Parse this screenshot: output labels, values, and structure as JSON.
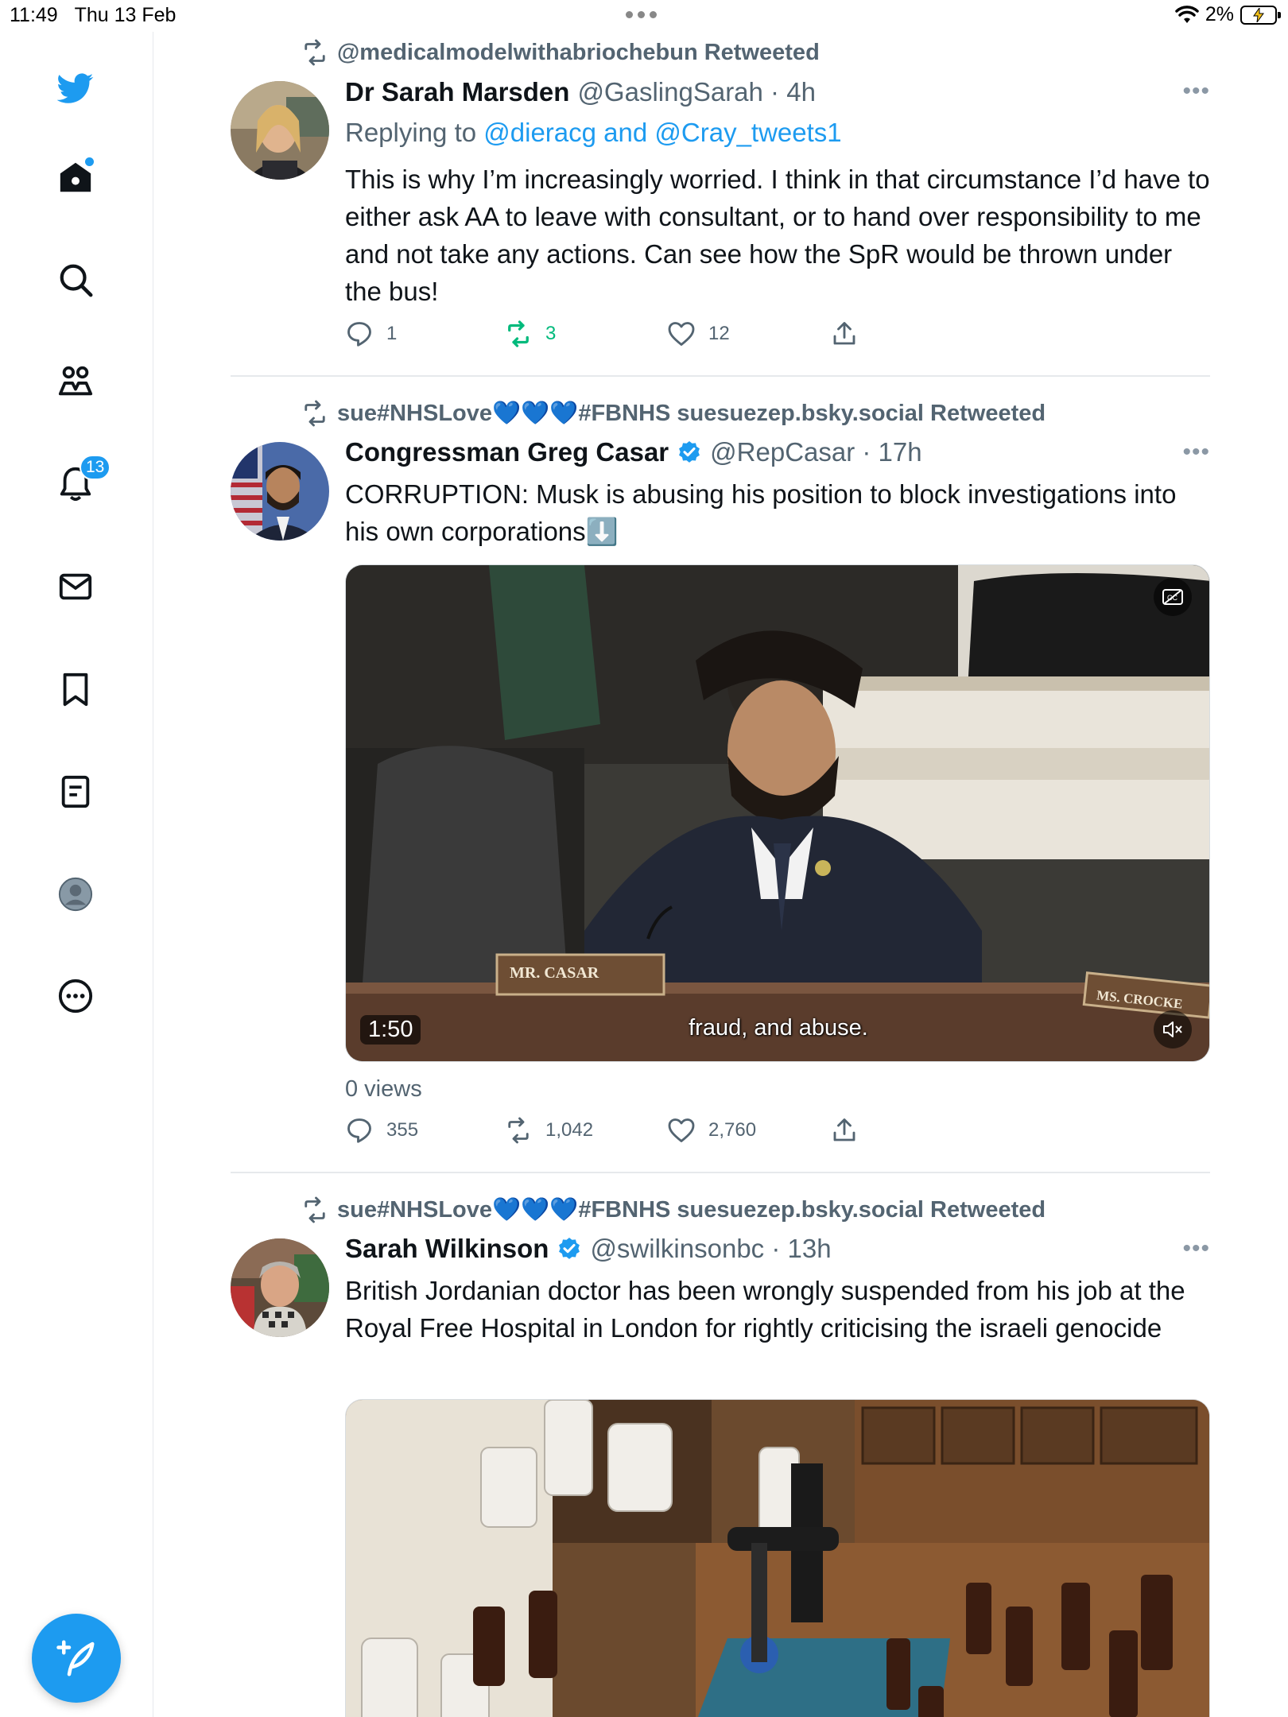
{
  "status_bar": {
    "time": "11:49",
    "date": "Thu 13 Feb",
    "battery": "2%"
  },
  "sidebar": {
    "notification_count": "13",
    "items": [
      "twitter-logo",
      "home-icon",
      "search-icon",
      "communities-icon",
      "notifications-icon",
      "messages-icon",
      "bookmarks-icon",
      "lists-icon",
      "profile-icon",
      "more-icon"
    ]
  },
  "colors": {
    "accent": "#1d9bf0",
    "retweet_active": "#00ba7c",
    "secondary_text": "#536471"
  },
  "tweets": [
    {
      "retweeted_by": "@medicalmodelwithabriochebun Retweeted",
      "name": "Dr Sarah Marsden",
      "handle": "@GaslingSarah · 4h",
      "replying_prefix": "Replying to ",
      "replying_mentions": "@dieracg and @Cray_tweets1",
      "text": "This is why I’m increasingly worried. I think in that circumstance I’d have to either ask AA to leave with consultant, or to hand over responsibility to me and not take any actions. Can see how the SpR would be thrown under the bus!",
      "replies": "1",
      "retweets": "3",
      "likes": "12"
    },
    {
      "retweeted_by": "sue#NHSLove💙💙💙#FBNHS suesuezep.bsky.social Retweeted",
      "name": "Congressman Greg Casar",
      "handle": "@RepCasar · 17h",
      "text": "CORRUPTION: Musk is abusing his position to block investigations into his own corporations⬇️",
      "video_duration": "1:50",
      "video_caption": "fraud, and abuse.",
      "nameplate_left": "MR. CASAR",
      "nameplate_right": "MS. CROCKE",
      "views": "0 views",
      "replies": "355",
      "retweets": "1,042",
      "likes": "2,760"
    },
    {
      "retweeted_by": "sue#NHSLove💙💙💙#FBNHS suesuezep.bsky.social Retweeted",
      "name": "Sarah Wilkinson",
      "handle": "@swilkinsonbc · 13h",
      "text": "British Jordanian doctor has been wrongly suspended from his job at the Royal Free Hospital in London for rightly criticising the israeli genocide"
    }
  ]
}
